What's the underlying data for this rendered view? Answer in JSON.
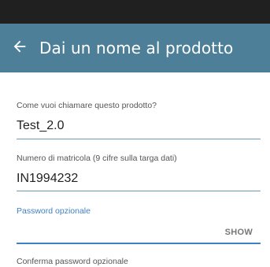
{
  "header": {
    "back_icon": "arrow-left-icon",
    "title": "Dai un nome al prodotto",
    "color": "#4e7f98"
  },
  "form": {
    "product_name": {
      "label": "Come vuoi chiamare questo prodotto?",
      "value": "Test_2.0"
    },
    "serial_number": {
      "label": "Numero di matricola (9 cifre sulla targa dati)",
      "value": "IN1994232"
    },
    "password": {
      "label": "Password opzionale",
      "value": "",
      "show_label": "SHOW"
    },
    "confirm_password": {
      "label": "Conferma password opzionale"
    }
  },
  "colors": {
    "accent": "#3f82c4",
    "status_bar": "#202021"
  }
}
